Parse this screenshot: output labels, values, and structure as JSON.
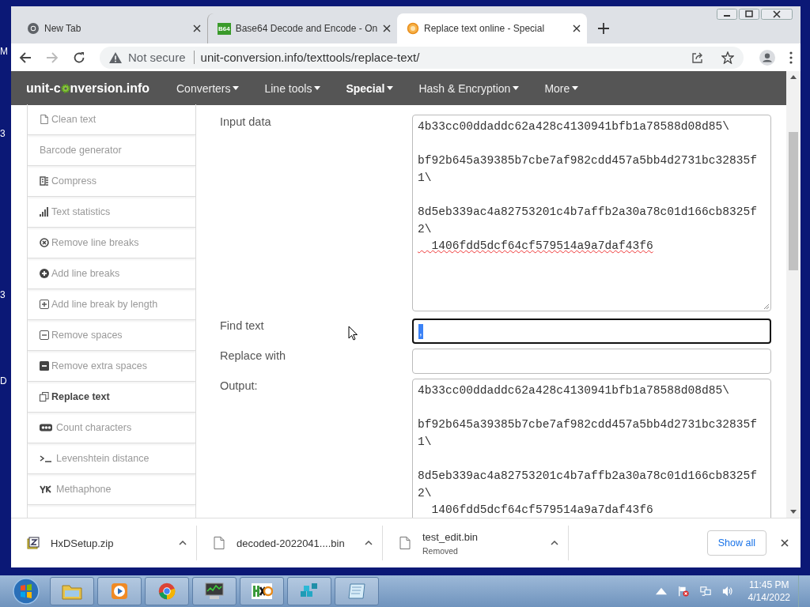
{
  "desktop_labels": [
    "M",
    "3",
    "3",
    "D"
  ],
  "tabs": [
    {
      "title": "New Tab",
      "selected": false
    },
    {
      "title": "Base64 Decode and Encode - On",
      "badge": "B64",
      "selected": false
    },
    {
      "title": "Replace text online - Special",
      "selected": true
    }
  ],
  "address": {
    "security": "Not secure",
    "url": "unit-conversion.info/texttools/replace-text/"
  },
  "site": {
    "logo_start": "unit-c",
    "logo_end": "nversion.info",
    "menu": [
      {
        "label": "Converters",
        "selected": false
      },
      {
        "label": "Line tools",
        "selected": false
      },
      {
        "label": "Special",
        "selected": true
      },
      {
        "label": "Hash & Encryption",
        "selected": false
      },
      {
        "label": "More",
        "selected": false
      }
    ]
  },
  "sidebar": [
    {
      "label": "Clean text",
      "selected": false
    },
    {
      "label": "Barcode generator",
      "selected": false
    },
    {
      "label": "Compress",
      "selected": false
    },
    {
      "label": "Text statistics",
      "selected": false
    },
    {
      "label": "Remove line breaks",
      "selected": false
    },
    {
      "label": "Add line breaks",
      "selected": false
    },
    {
      "label": "Add line break by length",
      "selected": false
    },
    {
      "label": "Remove spaces",
      "selected": false
    },
    {
      "label": "Remove extra spaces",
      "selected": false
    },
    {
      "label": "Replace text",
      "selected": true
    },
    {
      "label": "Count characters",
      "selected": false
    },
    {
      "label": "Levenshtein distance",
      "selected": false
    },
    {
      "label": "Methaphone",
      "selected": false
    }
  ],
  "form": [
    {
      "label": "Input data",
      "kind": "textarea",
      "blocks": [
        {
          "lines": [
            {
              "text": "4b33cc00ddaddc62a428c4130941bfb1a78588d08d85\\",
              "misspelled": false
            }
          ]
        },
        {
          "lines": [
            {
              "text": "bf92b645a39385b7cbe7af982cdd457a5bb4d2731bc32835f",
              "misspelled": false
            },
            {
              "text": "1\\",
              "misspelled": false
            }
          ]
        },
        {
          "lines": [
            {
              "text": "8d5eb339ac4a82753201c4b7affb2a30a78c01d166cb8325f",
              "misspelled": false
            },
            {
              "text": "2\\",
              "misspelled": false
            },
            {
              "text": "  1406fdd5dcf64cf579514a9a7daf43f6",
              "misspelled": true
            }
          ]
        }
      ]
    },
    {
      "label": "Find text",
      "kind": "input",
      "value": ",",
      "focused": true
    },
    {
      "label": "Replace with",
      "kind": "input",
      "focused": false
    },
    {
      "label": "Output:",
      "kind": "output",
      "blocks": [
        {
          "lines": [
            {
              "text": "4b33cc00ddaddc62a428c4130941bfb1a78588d08d85\\",
              "misspelled": false
            }
          ]
        },
        {
          "lines": [
            {
              "text": "bf92b645a39385b7cbe7af982cdd457a5bb4d2731bc32835f",
              "misspelled": false
            },
            {
              "text": "1\\",
              "misspelled": false
            }
          ]
        },
        {
          "lines": [
            {
              "text": "8d5eb339ac4a82753201c4b7affb2a30a78c01d166cb8325f",
              "misspelled": false
            },
            {
              "text": "2\\",
              "misspelled": false
            },
            {
              "text": "  1406fdd5dcf64cf579514a9a7daf43f6",
              "misspelled": false
            }
          ]
        }
      ]
    }
  ],
  "downloads": [
    {
      "name": "HxDSetup.zip"
    },
    {
      "name": "decoded-2022041....bin"
    },
    {
      "name": "test_edit.bin",
      "status": "Removed"
    }
  ],
  "show_all": "Show all",
  "taskbar": {
    "time": "11:45 PM",
    "date": "4/14/2022"
  }
}
